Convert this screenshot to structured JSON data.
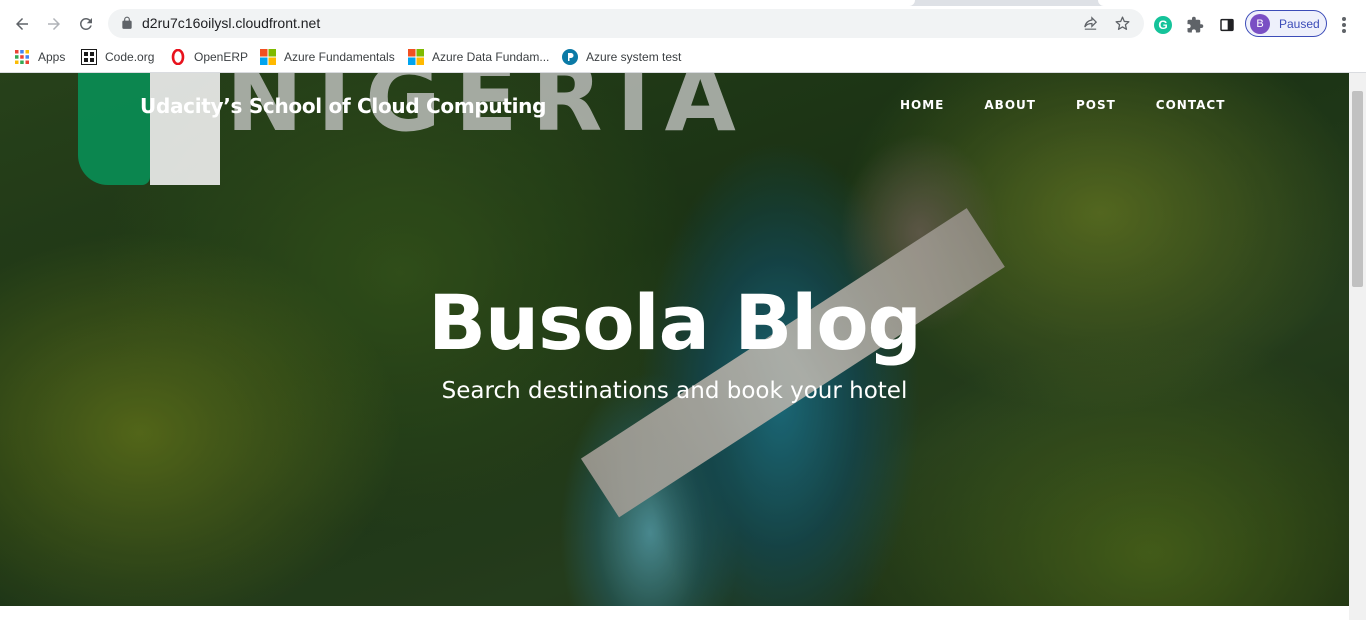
{
  "browser": {
    "url": "d2ru7c16oilysl.cloudfront.net",
    "profile_initial": "B",
    "profile_status": "Paused",
    "icons": {
      "back": "arrow-left-icon",
      "forward": "arrow-right-icon",
      "reload": "reload-icon",
      "lock": "lock-icon",
      "share": "share-icon",
      "bookmark": "star-icon",
      "grammarly": "grammarly-icon",
      "extensions": "puzzle-icon",
      "side_panel": "side-panel-icon",
      "menu": "kebab-menu-icon"
    },
    "grammarly_letter": "G"
  },
  "bookmarks": [
    {
      "label": "Apps",
      "icon": "apps-grid-icon"
    },
    {
      "label": "Code.org",
      "icon": "code-org-icon"
    },
    {
      "label": "OpenERP",
      "icon": "opera-icon"
    },
    {
      "label": "Azure Fundamentals",
      "icon": "microsoft-icon"
    },
    {
      "label": "Azure Data Fundam...",
      "icon": "microsoft-icon"
    },
    {
      "label": "Azure system test",
      "icon": "pearson-icon"
    }
  ],
  "site": {
    "brand": "Udacity’s School of Cloud Computing",
    "nav": [
      "HOME",
      "ABOUT",
      "POST",
      "CONTACT"
    ],
    "watermark": "NIGERIA",
    "hero_title": "Busola Blog",
    "hero_subtitle": "Search destinations and book your hotel"
  },
  "colors": {
    "profile_accent": "#3c4cb8",
    "avatar": "#7a4fc4",
    "grammarly": "#15c39a",
    "flag_green": "#0b8a52"
  }
}
